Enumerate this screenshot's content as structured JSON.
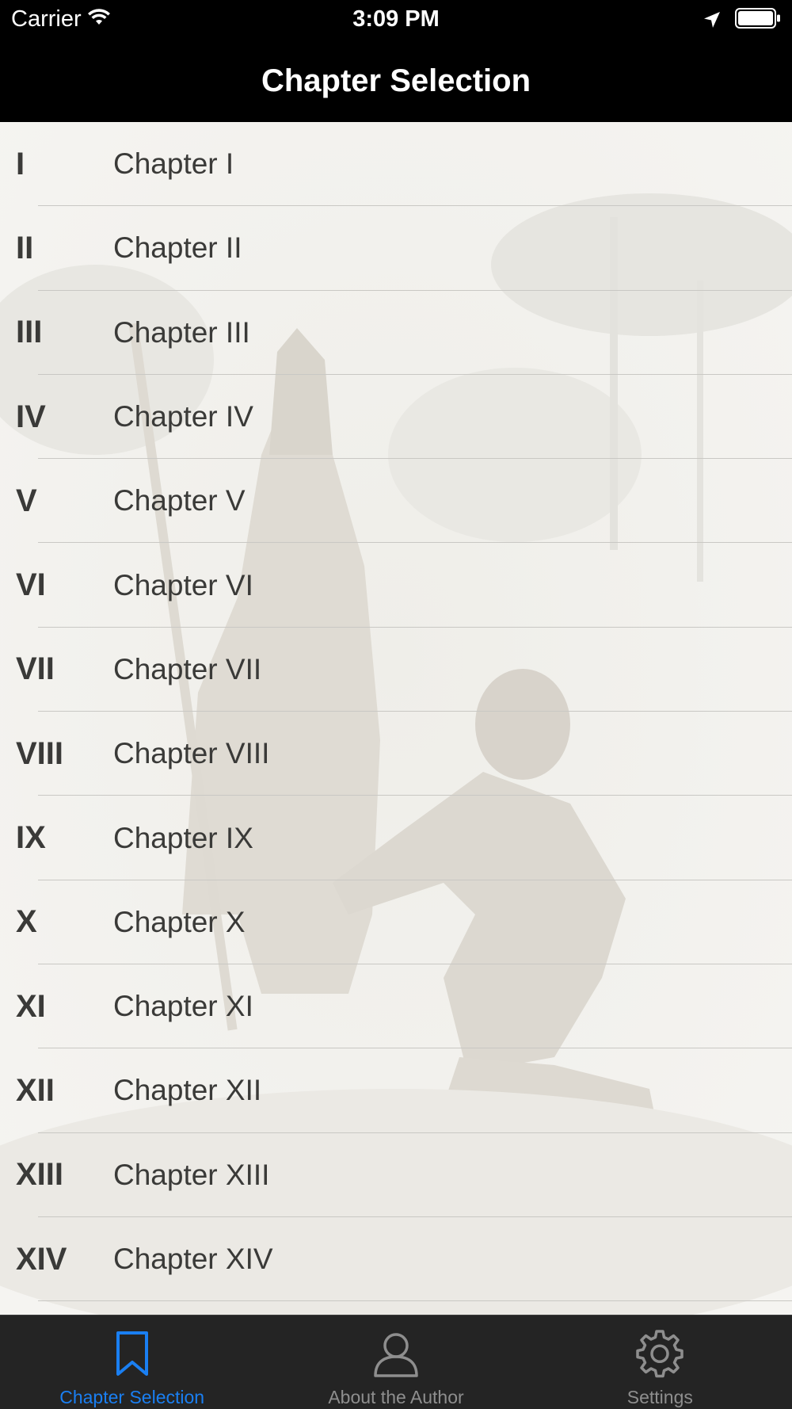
{
  "status_bar": {
    "carrier": "Carrier",
    "time": "3:09 PM",
    "icons": [
      "wifi-icon",
      "location-arrow-icon",
      "battery-icon"
    ]
  },
  "nav": {
    "title": "Chapter Selection"
  },
  "chapters": [
    {
      "numeral": "I",
      "title": "Chapter I"
    },
    {
      "numeral": "II",
      "title": "Chapter II"
    },
    {
      "numeral": "III",
      "title": "Chapter III"
    },
    {
      "numeral": "IV",
      "title": "Chapter IV"
    },
    {
      "numeral": "V",
      "title": "Chapter V"
    },
    {
      "numeral": "VI",
      "title": "Chapter VI"
    },
    {
      "numeral": "VII",
      "title": "Chapter VII"
    },
    {
      "numeral": "VIII",
      "title": "Chapter VIII"
    },
    {
      "numeral": "IX",
      "title": "Chapter IX"
    },
    {
      "numeral": "X",
      "title": "Chapter X"
    },
    {
      "numeral": "XI",
      "title": "Chapter XI"
    },
    {
      "numeral": "XII",
      "title": "Chapter XII"
    },
    {
      "numeral": "XIII",
      "title": "Chapter XIII"
    },
    {
      "numeral": "XIV",
      "title": "Chapter XIV"
    }
  ],
  "tab_bar": {
    "tabs": [
      {
        "label": "Chapter Selection",
        "icon": "bookmark-icon",
        "active": true
      },
      {
        "label": "About the Author",
        "icon": "person-icon",
        "active": false
      },
      {
        "label": "Settings",
        "icon": "gear-icon",
        "active": false
      }
    ]
  },
  "colors": {
    "accent": "#1a7ff2",
    "bar_background": "#000000",
    "tab_bar_background": "#242424",
    "list_text": "#3a3a38"
  }
}
